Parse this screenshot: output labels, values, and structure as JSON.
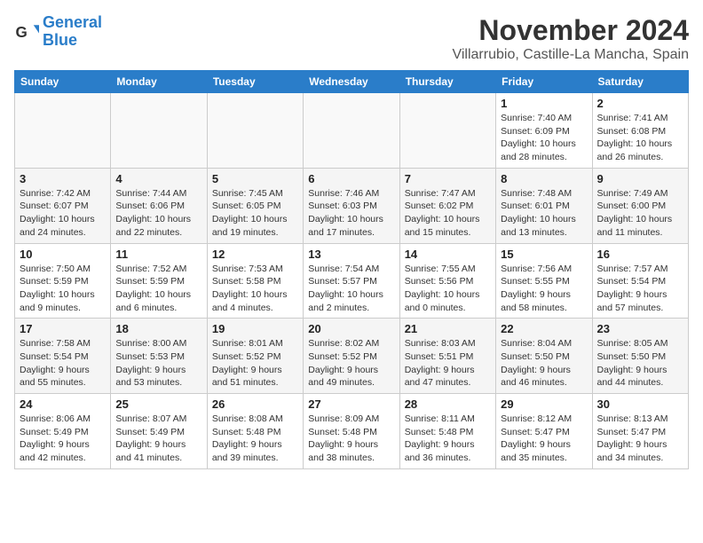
{
  "header": {
    "logo_line1": "General",
    "logo_line2": "Blue",
    "month_title": "November 2024",
    "location": "Villarrubio, Castille-La Mancha, Spain"
  },
  "weekdays": [
    "Sunday",
    "Monday",
    "Tuesday",
    "Wednesday",
    "Thursday",
    "Friday",
    "Saturday"
  ],
  "weeks": [
    [
      {
        "day": "",
        "info": ""
      },
      {
        "day": "",
        "info": ""
      },
      {
        "day": "",
        "info": ""
      },
      {
        "day": "",
        "info": ""
      },
      {
        "day": "",
        "info": ""
      },
      {
        "day": "1",
        "info": "Sunrise: 7:40 AM\nSunset: 6:09 PM\nDaylight: 10 hours and 28 minutes."
      },
      {
        "day": "2",
        "info": "Sunrise: 7:41 AM\nSunset: 6:08 PM\nDaylight: 10 hours and 26 minutes."
      }
    ],
    [
      {
        "day": "3",
        "info": "Sunrise: 7:42 AM\nSunset: 6:07 PM\nDaylight: 10 hours and 24 minutes."
      },
      {
        "day": "4",
        "info": "Sunrise: 7:44 AM\nSunset: 6:06 PM\nDaylight: 10 hours and 22 minutes."
      },
      {
        "day": "5",
        "info": "Sunrise: 7:45 AM\nSunset: 6:05 PM\nDaylight: 10 hours and 19 minutes."
      },
      {
        "day": "6",
        "info": "Sunrise: 7:46 AM\nSunset: 6:03 PM\nDaylight: 10 hours and 17 minutes."
      },
      {
        "day": "7",
        "info": "Sunrise: 7:47 AM\nSunset: 6:02 PM\nDaylight: 10 hours and 15 minutes."
      },
      {
        "day": "8",
        "info": "Sunrise: 7:48 AM\nSunset: 6:01 PM\nDaylight: 10 hours and 13 minutes."
      },
      {
        "day": "9",
        "info": "Sunrise: 7:49 AM\nSunset: 6:00 PM\nDaylight: 10 hours and 11 minutes."
      }
    ],
    [
      {
        "day": "10",
        "info": "Sunrise: 7:50 AM\nSunset: 5:59 PM\nDaylight: 10 hours and 9 minutes."
      },
      {
        "day": "11",
        "info": "Sunrise: 7:52 AM\nSunset: 5:59 PM\nDaylight: 10 hours and 6 minutes."
      },
      {
        "day": "12",
        "info": "Sunrise: 7:53 AM\nSunset: 5:58 PM\nDaylight: 10 hours and 4 minutes."
      },
      {
        "day": "13",
        "info": "Sunrise: 7:54 AM\nSunset: 5:57 PM\nDaylight: 10 hours and 2 minutes."
      },
      {
        "day": "14",
        "info": "Sunrise: 7:55 AM\nSunset: 5:56 PM\nDaylight: 10 hours and 0 minutes."
      },
      {
        "day": "15",
        "info": "Sunrise: 7:56 AM\nSunset: 5:55 PM\nDaylight: 9 hours and 58 minutes."
      },
      {
        "day": "16",
        "info": "Sunrise: 7:57 AM\nSunset: 5:54 PM\nDaylight: 9 hours and 57 minutes."
      }
    ],
    [
      {
        "day": "17",
        "info": "Sunrise: 7:58 AM\nSunset: 5:54 PM\nDaylight: 9 hours and 55 minutes."
      },
      {
        "day": "18",
        "info": "Sunrise: 8:00 AM\nSunset: 5:53 PM\nDaylight: 9 hours and 53 minutes."
      },
      {
        "day": "19",
        "info": "Sunrise: 8:01 AM\nSunset: 5:52 PM\nDaylight: 9 hours and 51 minutes."
      },
      {
        "day": "20",
        "info": "Sunrise: 8:02 AM\nSunset: 5:52 PM\nDaylight: 9 hours and 49 minutes."
      },
      {
        "day": "21",
        "info": "Sunrise: 8:03 AM\nSunset: 5:51 PM\nDaylight: 9 hours and 47 minutes."
      },
      {
        "day": "22",
        "info": "Sunrise: 8:04 AM\nSunset: 5:50 PM\nDaylight: 9 hours and 46 minutes."
      },
      {
        "day": "23",
        "info": "Sunrise: 8:05 AM\nSunset: 5:50 PM\nDaylight: 9 hours and 44 minutes."
      }
    ],
    [
      {
        "day": "24",
        "info": "Sunrise: 8:06 AM\nSunset: 5:49 PM\nDaylight: 9 hours and 42 minutes."
      },
      {
        "day": "25",
        "info": "Sunrise: 8:07 AM\nSunset: 5:49 PM\nDaylight: 9 hours and 41 minutes."
      },
      {
        "day": "26",
        "info": "Sunrise: 8:08 AM\nSunset: 5:48 PM\nDaylight: 9 hours and 39 minutes."
      },
      {
        "day": "27",
        "info": "Sunrise: 8:09 AM\nSunset: 5:48 PM\nDaylight: 9 hours and 38 minutes."
      },
      {
        "day": "28",
        "info": "Sunrise: 8:11 AM\nSunset: 5:48 PM\nDaylight: 9 hours and 36 minutes."
      },
      {
        "day": "29",
        "info": "Sunrise: 8:12 AM\nSunset: 5:47 PM\nDaylight: 9 hours and 35 minutes."
      },
      {
        "day": "30",
        "info": "Sunrise: 8:13 AM\nSunset: 5:47 PM\nDaylight: 9 hours and 34 minutes."
      }
    ]
  ]
}
